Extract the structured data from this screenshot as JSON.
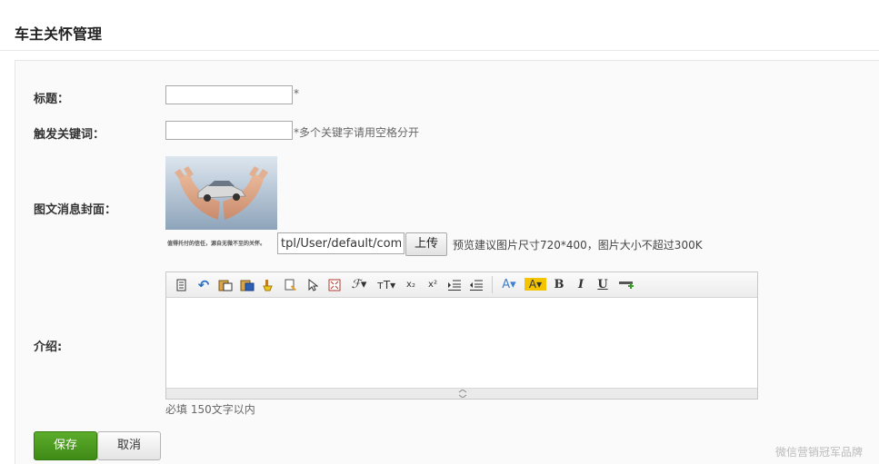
{
  "page": {
    "title": "车主关怀管理"
  },
  "form": {
    "title_label": "标题：",
    "title_value": "",
    "title_required_mark": "*",
    "keyword_label": "触发关键词：",
    "keyword_value": "",
    "keyword_hint": "*多个关键字请用空格分开",
    "cover_label": "图文消息封面：",
    "cover_caption": "值得托付的信任，源自无微不至的关怀。",
    "cover_path_value": "tpl/User/default/comm",
    "upload_label": "上传",
    "cover_hint": "预览建议图片尺寸720*400，图片大小不超过300K",
    "intro_label": "介绍:",
    "intro_hint": "必填 150文字以内",
    "save_label": "保存",
    "cancel_label": "取消"
  },
  "editor": {
    "toolbar": [
      {
        "name": "source-icon",
        "glyph": ""
      },
      {
        "name": "undo-icon",
        "glyph": "↶"
      },
      {
        "name": "paste-icon",
        "glyph": ""
      },
      {
        "name": "paste-word-icon",
        "glyph": ""
      },
      {
        "name": "clear-format-icon",
        "glyph": ""
      },
      {
        "name": "format-brush-icon",
        "glyph": ""
      },
      {
        "name": "select-all-icon",
        "glyph": ""
      },
      {
        "name": "fullscreen-icon",
        "glyph": ""
      },
      {
        "name": "font-family-icon",
        "glyph": "ℱ▾"
      },
      {
        "name": "font-size-icon",
        "glyph": "ᴛT▾"
      },
      {
        "name": "subscript-icon",
        "glyph": "x₂"
      },
      {
        "name": "superscript-icon",
        "glyph": "x²"
      },
      {
        "name": "indent-icon",
        "glyph": ""
      },
      {
        "name": "outdent-icon",
        "glyph": ""
      },
      {
        "name": "font-color-icon",
        "glyph": "A▾"
      },
      {
        "name": "highlight-color-icon",
        "glyph": "A▾"
      },
      {
        "name": "bold-icon",
        "glyph": "B"
      },
      {
        "name": "italic-icon",
        "glyph": "I"
      },
      {
        "name": "underline-icon",
        "glyph": "U"
      },
      {
        "name": "horizontal-rule-icon",
        "glyph": ""
      }
    ]
  },
  "watermark": "微信营销冠军品牌",
  "colors": {
    "save_button": "#4a9b22",
    "accent_font_color": "#3d7fd0",
    "highlight": "#f5c400"
  }
}
